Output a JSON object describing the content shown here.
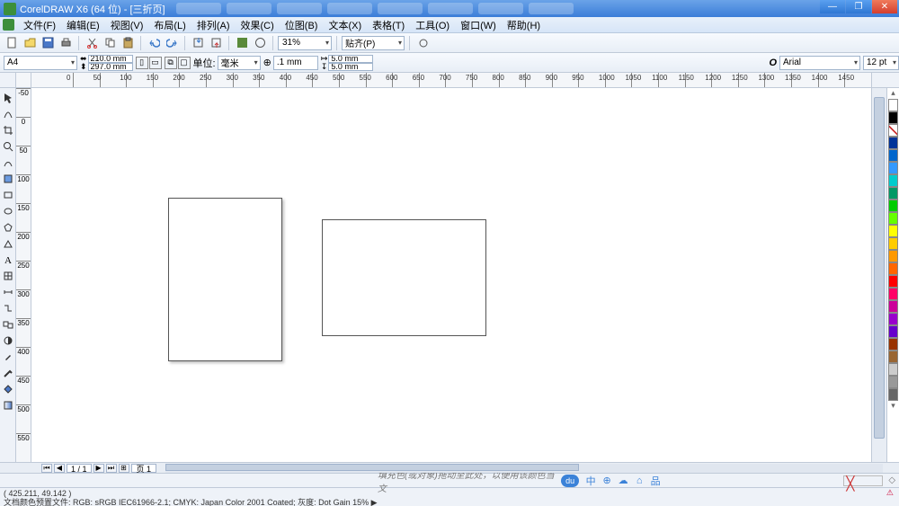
{
  "titlebar": {
    "app_name": "CorelDRAW X6 (64 位) - [三折页]"
  },
  "menu": {
    "items": [
      "文件(F)",
      "编辑(E)",
      "视图(V)",
      "布局(L)",
      "排列(A)",
      "效果(C)",
      "位图(B)",
      "文本(X)",
      "表格(T)",
      "工具(O)",
      "窗口(W)",
      "帮助(H)"
    ]
  },
  "toolbar": {
    "zoom": "31%",
    "snap_label": "贴齐(P)"
  },
  "propbar": {
    "page_preset": "A4",
    "width": "210.0 mm",
    "height": "297.0 mm",
    "units_label": "单位:",
    "units_value": "毫米",
    "nudge": ".1 mm",
    "dup_x": "5.0 mm",
    "dup_y": "5.0 mm",
    "font_name": "Arial",
    "font_size": "12 pt"
  },
  "ruler": {
    "h_ticks": [
      "0",
      "50",
      "100",
      "150",
      "200",
      "250",
      "300",
      "350",
      "400",
      "450",
      "500",
      "550",
      "600",
      "650",
      "700",
      "750",
      "800",
      "850",
      "900",
      "950",
      "1000",
      "1050",
      "1100",
      "1150",
      "1200",
      "1250",
      "1300",
      "1350",
      "1400",
      "1450"
    ],
    "v_start": -50,
    "v_step": 50
  },
  "pagenav": {
    "page_of": "1 / 1",
    "tab_label": "页 1"
  },
  "hint": {
    "left_text": "填充色(或对象)拖动至此处，以便用该颜色当文",
    "symbols": [
      "中",
      "⊕",
      "☁",
      "⌂",
      "品"
    ]
  },
  "status": {
    "coords": "( 425.211, 49.142 )",
    "profile": "文档颜色预置文件: RGB: sRGB IEC61966-2.1; CMYK: Japan Color 2001 Coated; 灰度: Dot Gain 15% ▶"
  },
  "palette_colors": [
    "#ffffff",
    "#000000",
    "transparent",
    "#003399",
    "#0066cc",
    "#3399ff",
    "#00cccc",
    "#009966",
    "#00cc00",
    "#66ff00",
    "#ffff00",
    "#ffcc00",
    "#ff9900",
    "#ff6600",
    "#ff0000",
    "#ff0066",
    "#cc0099",
    "#9900cc",
    "#6600cc",
    "#993300",
    "#996633",
    "#cccccc",
    "#999999",
    "#666666"
  ]
}
